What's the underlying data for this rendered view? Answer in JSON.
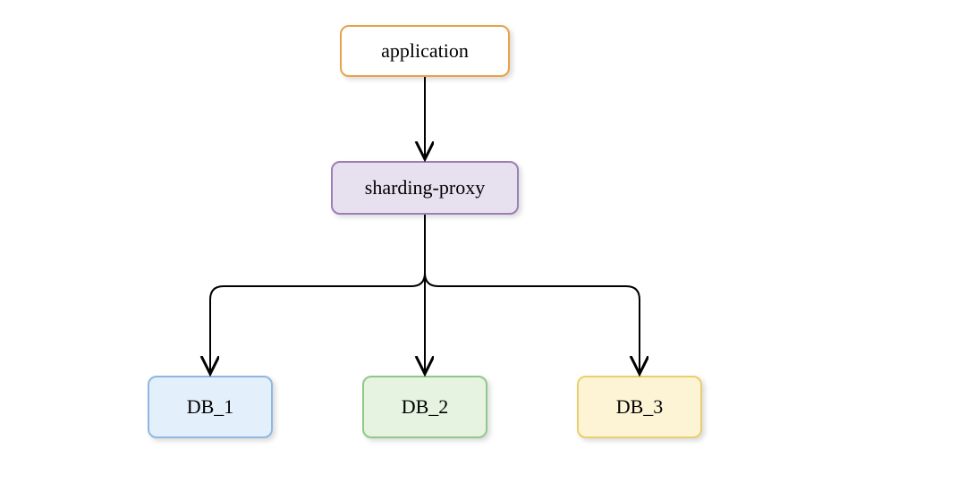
{
  "diagram": {
    "nodes": {
      "application": {
        "label": "application",
        "fill": "#ffffff",
        "border": "#e8a24a"
      },
      "proxy": {
        "label": "sharding-proxy",
        "fill": "#e7e0ef",
        "border": "#9b7fb8"
      },
      "db1": {
        "label": "DB_1",
        "fill": "#e3effb",
        "border": "#8fb8e0"
      },
      "db2": {
        "label": "DB_2",
        "fill": "#e5f3e0",
        "border": "#8fc98a"
      },
      "db3": {
        "label": "DB_3",
        "fill": "#fdf4d5",
        "border": "#e8cf6e"
      }
    },
    "edges": [
      {
        "from": "application",
        "to": "proxy"
      },
      {
        "from": "proxy",
        "to": "db1"
      },
      {
        "from": "proxy",
        "to": "db2"
      },
      {
        "from": "proxy",
        "to": "db3"
      }
    ]
  }
}
